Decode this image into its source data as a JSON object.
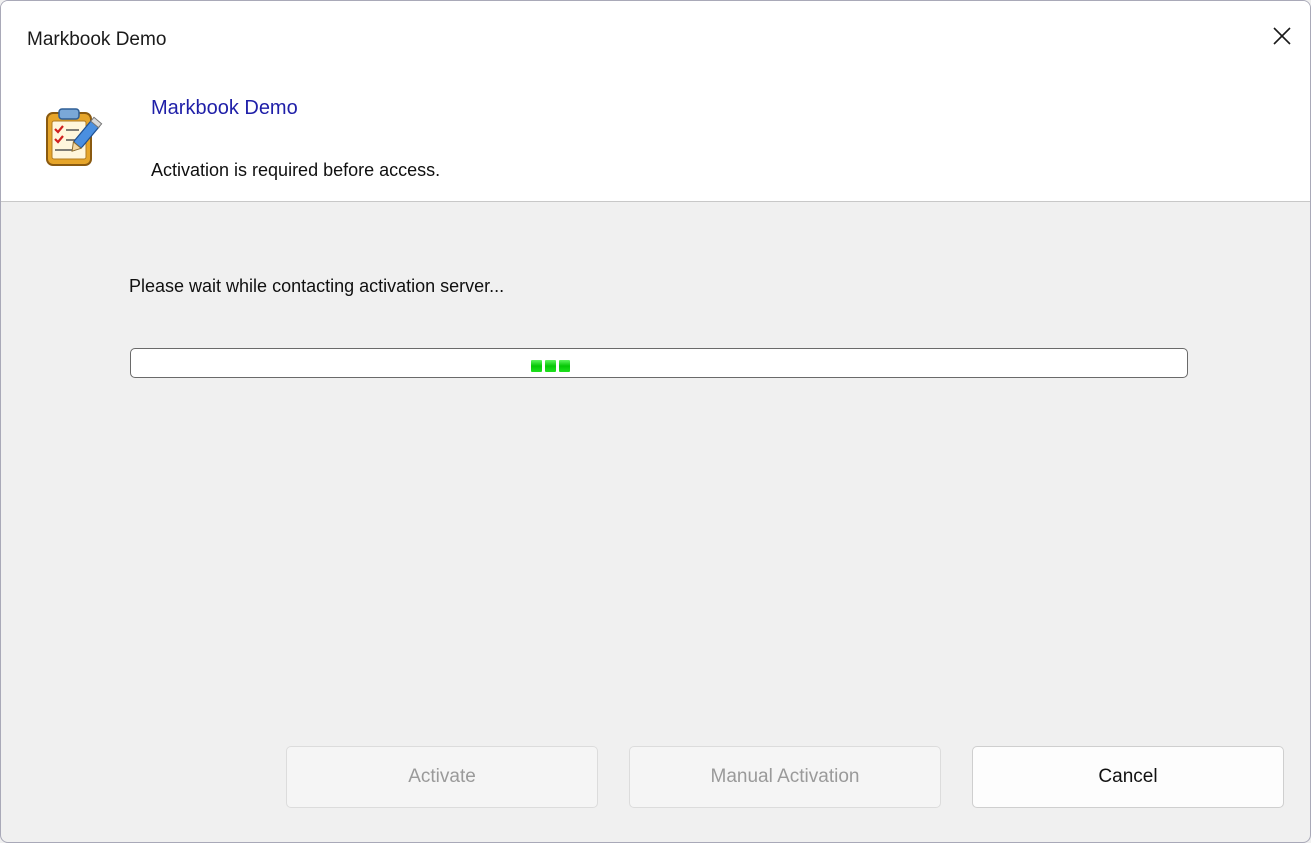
{
  "window": {
    "title": "Markbook Demo"
  },
  "header": {
    "title": "Markbook Demo",
    "subtitle": "Activation is required before access.",
    "icon": "markbook-clipboard-icon"
  },
  "status": {
    "message": "Please wait while contacting activation server...",
    "progress_mode": "indeterminate",
    "progress_color": "#06c706"
  },
  "buttons": {
    "activate": "Activate",
    "manual_activation": "Manual Activation",
    "cancel": "Cancel"
  },
  "colors": {
    "header_title": "#1f1fa8",
    "dialog_bg": "#f0f0f0"
  }
}
